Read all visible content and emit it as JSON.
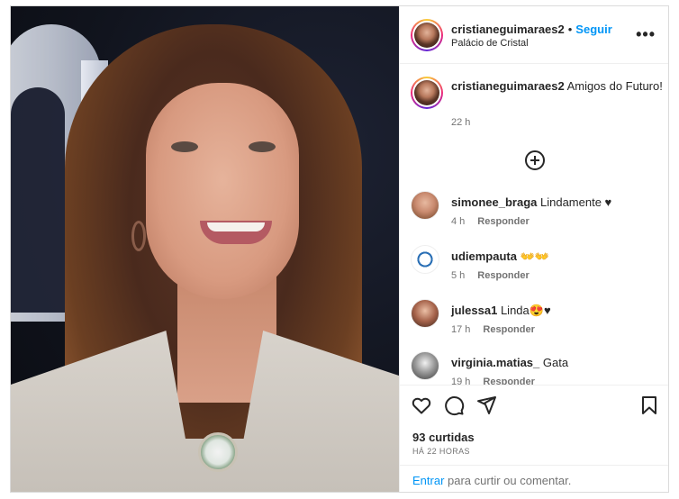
{
  "post": {
    "username": "cristianeguimaraes2",
    "follow_label": "Seguir",
    "dot": "•",
    "location": "Palácio de Cristal",
    "more_label": "•••",
    "caption": "Amigos do Futuro!",
    "caption_time": "22 h",
    "photo_icon": "selfie-photo"
  },
  "comments": [
    {
      "username": "simonee_braga",
      "text": "Lindamente ♥",
      "time": "4 h",
      "reply": "Responder",
      "avatar_color": "#c98a6f"
    },
    {
      "username": "udiempauta",
      "text": "👐👐",
      "time": "5 h",
      "reply": "Responder",
      "avatar_color": "#2a6fb5"
    },
    {
      "username": "julessa1",
      "text": "Linda😍♥",
      "time": "17 h",
      "reply": "Responder",
      "avatar_color": "#a5624a"
    },
    {
      "username": "virginia.matias_",
      "text": "Gata",
      "time": "19 h",
      "reply": "Responder",
      "avatar_color": "#6b6b6b"
    }
  ],
  "actions": {
    "likes": "93 curtidas",
    "ago": "Há 22 horas",
    "login_link": "Entrar",
    "login_text": " para curtir ou comentar."
  },
  "colors": {
    "accent": "#0095f6",
    "text": "#262626",
    "muted": "#737373"
  },
  "icons": [
    "heart-icon",
    "comment-icon",
    "share-icon",
    "bookmark-icon",
    "plus-circle-icon",
    "more-icon"
  ]
}
